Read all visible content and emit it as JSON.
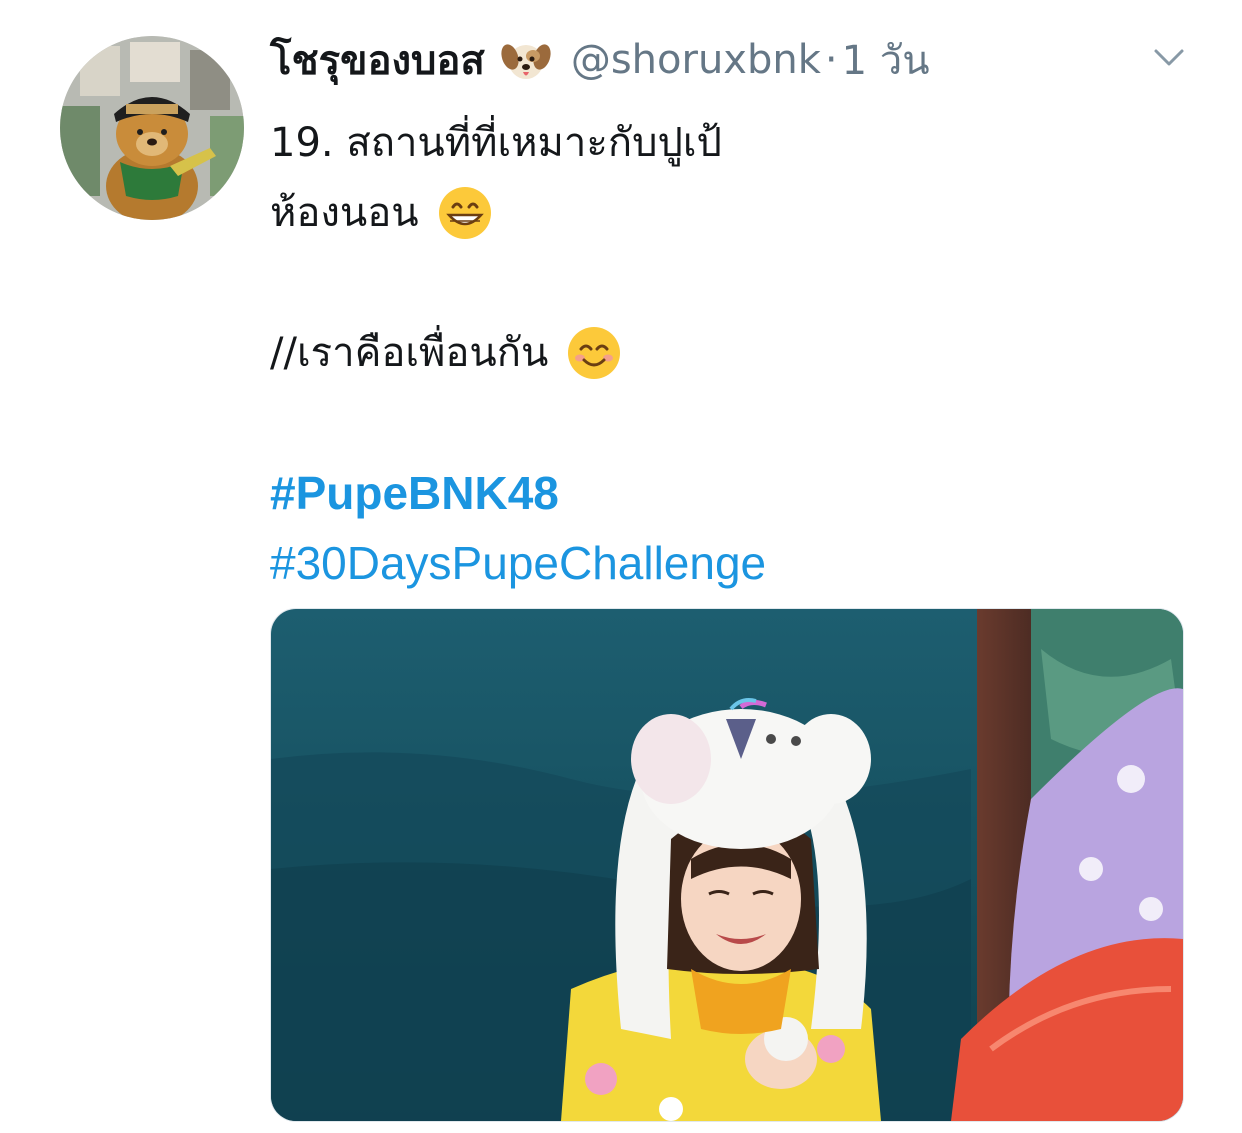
{
  "tweet": {
    "display_name": "โชรุของบอส",
    "name_emoji": "dog-face-emoji",
    "handle": "@shoruxbnk",
    "separator": "·",
    "timestamp": "1 วัน",
    "more_icon": "chevron-down-icon",
    "lines": [
      "19. สถานที่ที่เหมาะกับปูเป้",
      "ห้องนอน",
      "//เราคือเพื่อนกัน"
    ],
    "line_emojis": [
      "",
      "grinning-face-emoji",
      "smiling-face-emoji"
    ],
    "hashtags": [
      "#PupeBNK48",
      "#30DaysPupeChallenge"
    ]
  },
  "colors": {
    "text": "#14171a",
    "secondary": "#657786",
    "link": "#1b95e0",
    "border": "#e1e8ed"
  }
}
